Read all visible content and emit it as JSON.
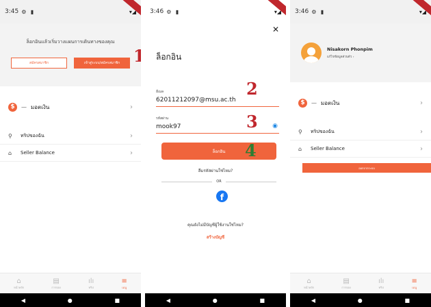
{
  "panel1": {
    "status_time": "3:45",
    "prompt": "ล็อกอินแล้วเริ่มวางแผนการเดินทางของคุณ",
    "btn_register": "สมัครสมาชิก",
    "btn_login": "เข้าสู่ระบบ/สมัครสมาชิก",
    "wallet_label": "มอตเงิน",
    "menu": [
      "ทริปของฉัน",
      "Seller Balance"
    ],
    "step_number": "1"
  },
  "panel2": {
    "status_time": "3:46",
    "title": "ล็อกอิน",
    "email_label": "อีเมล",
    "email_value": "62011212097@msu.ac.th",
    "password_label": "รหัสผ่าน",
    "password_value": "mook97",
    "login_button": "ล็อกอิน",
    "forgot": "ลืมรหัสผ่านใช่ไหม?",
    "or": "OR",
    "no_account": "คุณยังไม่มีบัญชีผู้ใช้งานใช่ไหม?",
    "signup": "สร้างบัญชี",
    "step2": "2",
    "step3": "3",
    "step4": "4"
  },
  "panel3": {
    "status_time": "3:46",
    "name": "Nisakorn Phonpim",
    "subtitle": "แก้ไขข้อมูลส่วนตัว",
    "wallet_label": "มอตเงิน",
    "menu": [
      "ทริปของฉัน",
      "Seller Balance"
    ],
    "logout": "ออกจากระบบ"
  },
  "nav": [
    "หน้าหลัก",
    "การจอง",
    "ทริป",
    "เมนู"
  ],
  "colors": {
    "accent": "#f0643c",
    "annotation_red": "#c0272d",
    "annotation_green": "#2e7d32",
    "facebook": "#1877f2"
  },
  "icons": {
    "wallet": "coin-icon",
    "trip": "location-pin-icon",
    "balance": "bank-icon",
    "eye": "eye-icon",
    "close": "close-icon"
  }
}
